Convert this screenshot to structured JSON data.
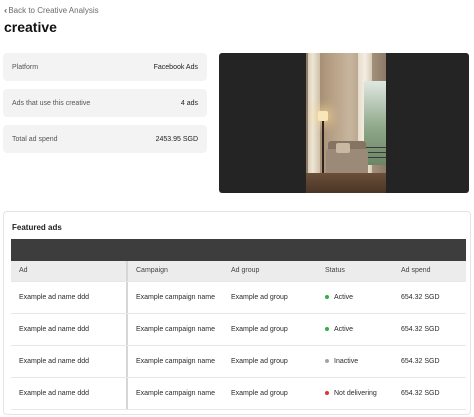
{
  "header": {
    "back_label": "Back to Creative Analysis",
    "title": "creative"
  },
  "info_cards": [
    {
      "label": "Platform",
      "value": "Facebook Ads"
    },
    {
      "label": "Ads that use this creative",
      "value": "4 ads"
    },
    {
      "label": "Total ad spend",
      "value": "2453.95 SGD"
    }
  ],
  "featured": {
    "title": "Featured ads",
    "columns": [
      "Ad",
      "Campaign",
      "Ad group",
      "Status",
      "Ad spend"
    ],
    "rows": [
      {
        "ad": "Example ad name ddd",
        "campaign": "Example campaign name",
        "ad_group": "Example ad group",
        "status": "Active",
        "status_color": "#2bb34a",
        "spend": "654.32 SGD"
      },
      {
        "ad": "Example ad name ddd",
        "campaign": "Example campaign name",
        "ad_group": "Example ad group",
        "status": "Active",
        "status_color": "#2bb34a",
        "spend": "654.32 SGD"
      },
      {
        "ad": "Example ad name ddd",
        "campaign": "Example campaign name",
        "ad_group": "Example ad group",
        "status": "Inactive",
        "status_color": "#a3a3a3",
        "spend": "654.32 SGD"
      },
      {
        "ad": "Example ad name ddd",
        "campaign": "Example campaign name",
        "ad_group": "Example ad group",
        "status": "Not delivering",
        "status_color": "#e0342e",
        "spend": "654.32 SGD"
      }
    ]
  }
}
